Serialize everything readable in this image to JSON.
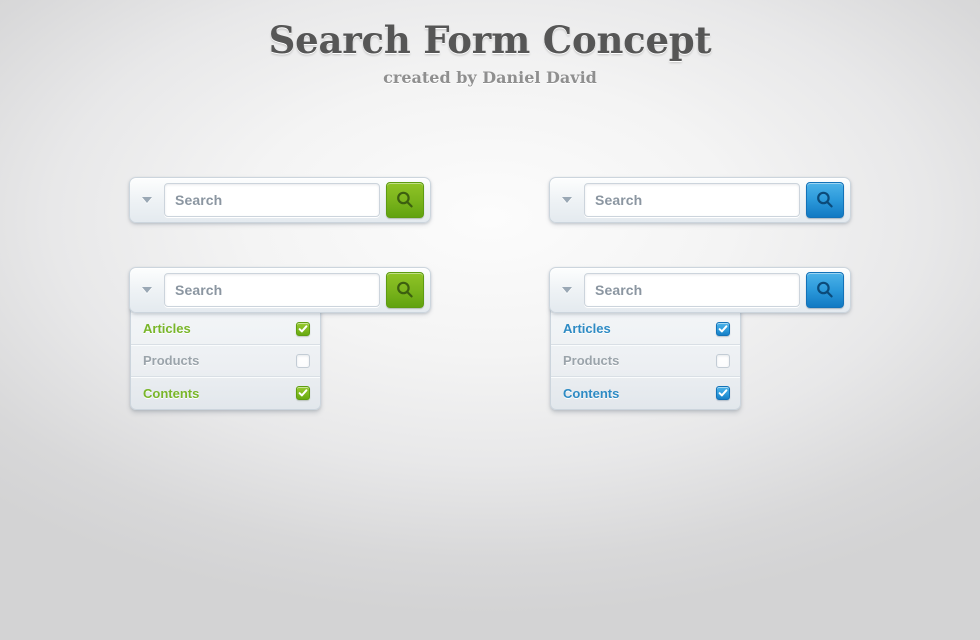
{
  "header": {
    "title": "Search Form Concept",
    "subtitle": "created by Daniel David"
  },
  "colors": {
    "green_accent": "#7ab82a",
    "blue_accent": "#2e8bc4",
    "label_off": "#9ba4ab",
    "placeholder": "#8b96a1",
    "title": "#565656",
    "subtitle": "#8f8f8f",
    "background": "#d6d6d7"
  },
  "search": {
    "placeholder": "Search",
    "dropdown_toggle_icon": "chevron-down-icon",
    "submit_icon": "search-icon"
  },
  "options": [
    {
      "label": "Articles",
      "checked": true
    },
    {
      "label": "Products",
      "checked": false
    },
    {
      "label": "Contents",
      "checked": true
    }
  ],
  "widgets": [
    {
      "id": "green-collapsed",
      "theme": "green",
      "expanded": false
    },
    {
      "id": "blue-collapsed",
      "theme": "blue",
      "expanded": false
    },
    {
      "id": "green-expanded",
      "theme": "green",
      "expanded": true
    },
    {
      "id": "blue-expanded",
      "theme": "blue",
      "expanded": true
    }
  ]
}
